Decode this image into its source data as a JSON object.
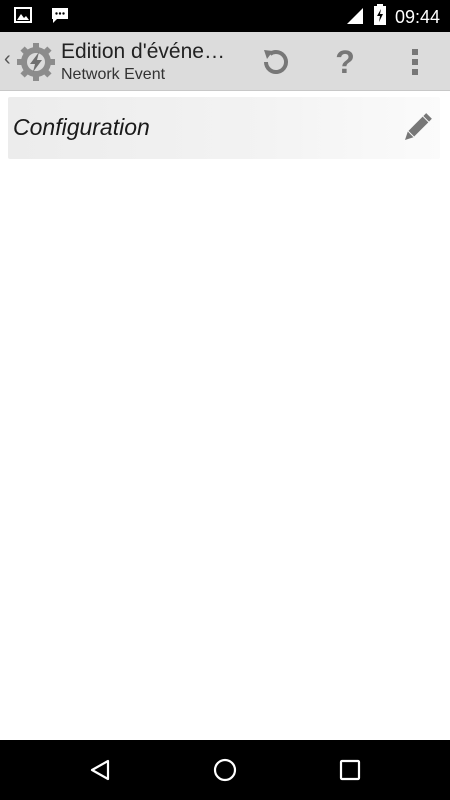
{
  "status_bar": {
    "time": "09:44",
    "icons": [
      "image-icon",
      "message-icon",
      "signal-icon",
      "battery-charging-icon"
    ]
  },
  "action_bar": {
    "title": "Edition d'événe…",
    "subtitle": "Network Event",
    "actions": [
      "revert-icon",
      "help-icon",
      "overflow-menu-icon"
    ]
  },
  "config": {
    "label": "Configuration"
  },
  "nav_bar": {
    "buttons": [
      "back-icon",
      "home-icon",
      "recents-icon"
    ]
  },
  "colors": {
    "action_bar_bg": "#dcdcdc",
    "status_bar_bg": "#000000",
    "icon_gray": "#777777"
  }
}
